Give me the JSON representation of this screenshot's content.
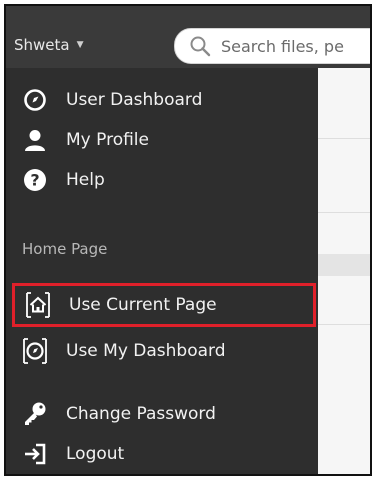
{
  "user_menu": {
    "username": "Shweta",
    "caret": "▼"
  },
  "search": {
    "placeholder": "Search files, pe"
  },
  "menu": {
    "items": [
      {
        "label": "User Dashboard",
        "icon": "dashboard-icon"
      },
      {
        "label": "My Profile",
        "icon": "user-icon"
      },
      {
        "label": "Help",
        "icon": "help-icon"
      }
    ],
    "home_page_header": "Home Page",
    "home_page_items": [
      {
        "label": "Use Current Page",
        "icon": "home-icon"
      },
      {
        "label": "Use My Dashboard",
        "icon": "dashboard-icon"
      }
    ],
    "account_items": [
      {
        "label": "Change Password",
        "icon": "key-icon"
      },
      {
        "label": "Logout",
        "icon": "logout-icon"
      }
    ]
  },
  "colors": {
    "menu_background": "#2e2e2e",
    "topbar_background": "#3a3a3a",
    "highlight_border": "#e0202a",
    "menu_text": "#f2f2f2"
  }
}
